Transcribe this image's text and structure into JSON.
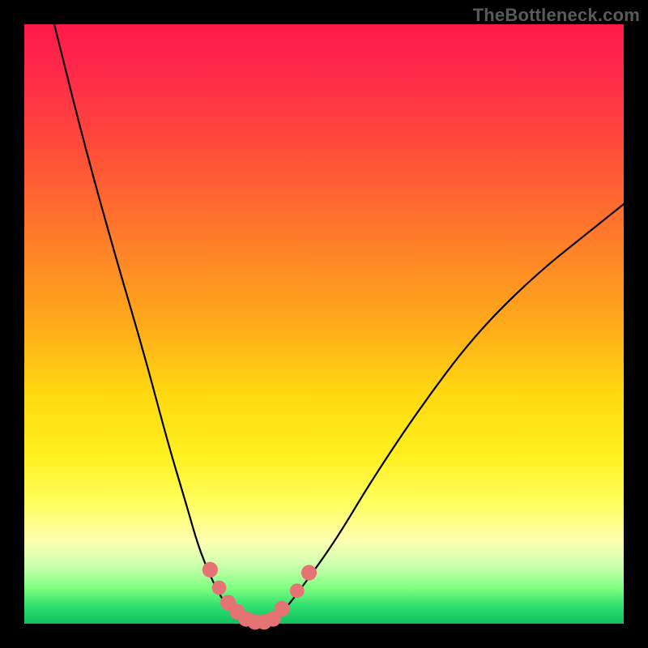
{
  "watermark": "TheBottleneck.com",
  "chart_data": {
    "type": "line",
    "title": "",
    "xlabel": "",
    "ylabel": "",
    "xlim": [
      0,
      100
    ],
    "ylim": [
      0,
      100
    ],
    "grid": false,
    "legend": false,
    "annotations": [],
    "series": [
      {
        "name": "bottleneck-curve",
        "color": "#000000",
        "x": [
          5,
          10,
          15,
          20,
          24,
          27,
          29,
          31,
          33,
          35,
          37,
          38,
          39,
          40,
          42,
          44,
          47,
          52,
          58,
          66,
          75,
          85,
          95,
          100
        ],
        "values": [
          100,
          80,
          62,
          45,
          30,
          20,
          13,
          8,
          4,
          2,
          1,
          0,
          0,
          0,
          1,
          3,
          7,
          14,
          24,
          36,
          48,
          58,
          66,
          70
        ]
      }
    ],
    "markers": [
      {
        "name": "marker-left-high",
        "x": 31.0,
        "y": 9.0,
        "r": 1.3,
        "color": "#e57373"
      },
      {
        "name": "marker-left-mid",
        "x": 32.5,
        "y": 6.0,
        "r": 1.2,
        "color": "#e57373"
      },
      {
        "name": "marker-left-low1",
        "x": 34.0,
        "y": 3.5,
        "r": 1.3,
        "color": "#e57373"
      },
      {
        "name": "marker-left-low2",
        "x": 35.5,
        "y": 2.0,
        "r": 1.3,
        "color": "#e57373"
      },
      {
        "name": "marker-bottom-l",
        "x": 37.0,
        "y": 0.8,
        "r": 1.3,
        "color": "#e57373"
      },
      {
        "name": "marker-bottom-c1",
        "x": 38.5,
        "y": 0.3,
        "r": 1.3,
        "color": "#e57373"
      },
      {
        "name": "marker-bottom-c2",
        "x": 40.0,
        "y": 0.3,
        "r": 1.3,
        "color": "#e57373"
      },
      {
        "name": "marker-bottom-r",
        "x": 41.5,
        "y": 0.8,
        "r": 1.3,
        "color": "#e57373"
      },
      {
        "name": "marker-right-low",
        "x": 43.0,
        "y": 2.5,
        "r": 1.3,
        "color": "#e57373"
      },
      {
        "name": "marker-right-mid",
        "x": 45.5,
        "y": 5.5,
        "r": 1.2,
        "color": "#e57373"
      },
      {
        "name": "marker-right-high",
        "x": 47.5,
        "y": 8.5,
        "r": 1.3,
        "color": "#e57373"
      }
    ]
  }
}
